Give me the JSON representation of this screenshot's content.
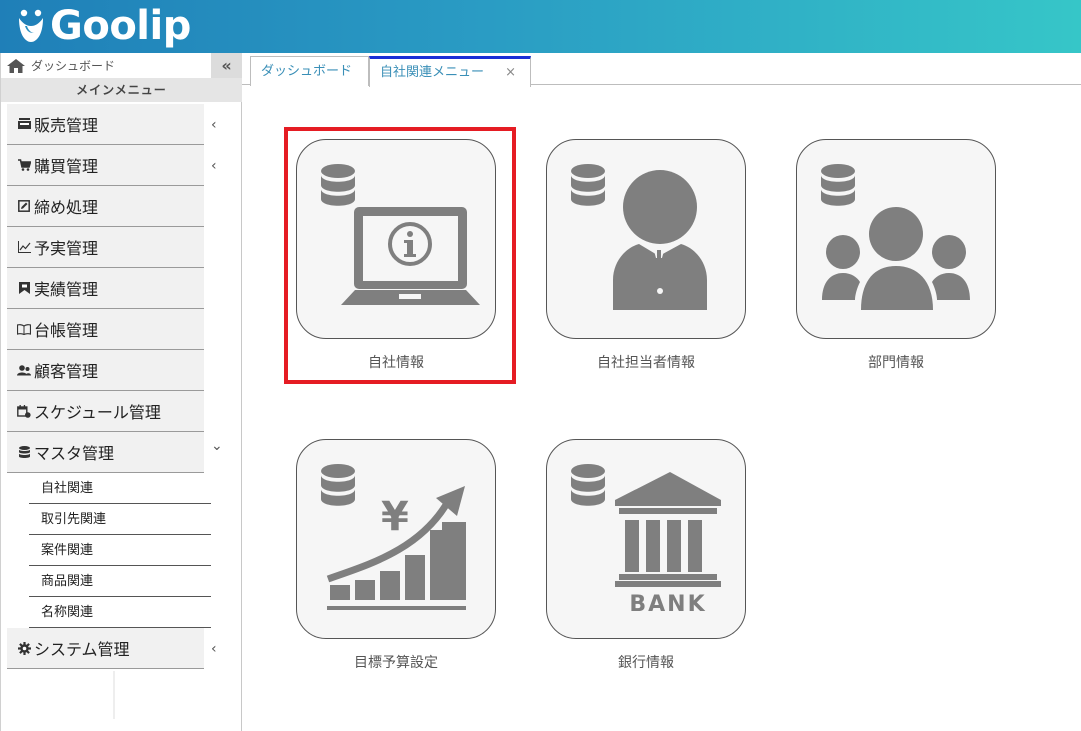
{
  "app": {
    "logo_text": "Goolip"
  },
  "sidebar": {
    "home_label": "ダッシュボード",
    "collapse_label": "«",
    "main_menu_label": "メインメニュー",
    "items": [
      {
        "label": "販売管理",
        "icon": "register-icon",
        "chevron": "‹"
      },
      {
        "label": "購買管理",
        "icon": "cart-icon",
        "chevron": "‹"
      },
      {
        "label": "締め処理",
        "icon": "edit-box-icon",
        "chevron": ""
      },
      {
        "label": "予実管理",
        "icon": "line-chart-icon",
        "chevron": ""
      },
      {
        "label": "実績管理",
        "icon": "bookmark-icon",
        "chevron": ""
      },
      {
        "label": "台帳管理",
        "icon": "book-icon",
        "chevron": ""
      },
      {
        "label": "顧客管理",
        "icon": "users-icon",
        "chevron": ""
      },
      {
        "label": "スケジュール管理",
        "icon": "calendar-icon",
        "chevron": ""
      },
      {
        "label": "マスタ管理",
        "icon": "database-icon",
        "chevron": "⌄"
      }
    ],
    "sub_items": [
      "自社関連",
      "取引先関連",
      "案件関連",
      "商品関連",
      "名称関連"
    ],
    "system_item": {
      "label": "システム管理",
      "icon": "gear-icon",
      "chevron": "‹"
    }
  },
  "tabs": [
    {
      "label": "ダッシュボード"
    },
    {
      "label": "自社関連メニュー",
      "close": "×"
    }
  ],
  "tiles": [
    {
      "label": "自社情報",
      "icon": "laptop-info-icon"
    },
    {
      "label": "自社担当者情報",
      "icon": "person-icon"
    },
    {
      "label": "部門情報",
      "icon": "group-icon"
    },
    {
      "label": "目標予算設定",
      "icon": "yen-growth-icon"
    },
    {
      "label": "銀行情報",
      "icon": "bank-icon",
      "bank_text": "BANK"
    }
  ],
  "colors": {
    "highlight": "#e51c23",
    "icon_gray": "#7f7f7f",
    "tab_active_border": "#1b2fd6"
  }
}
